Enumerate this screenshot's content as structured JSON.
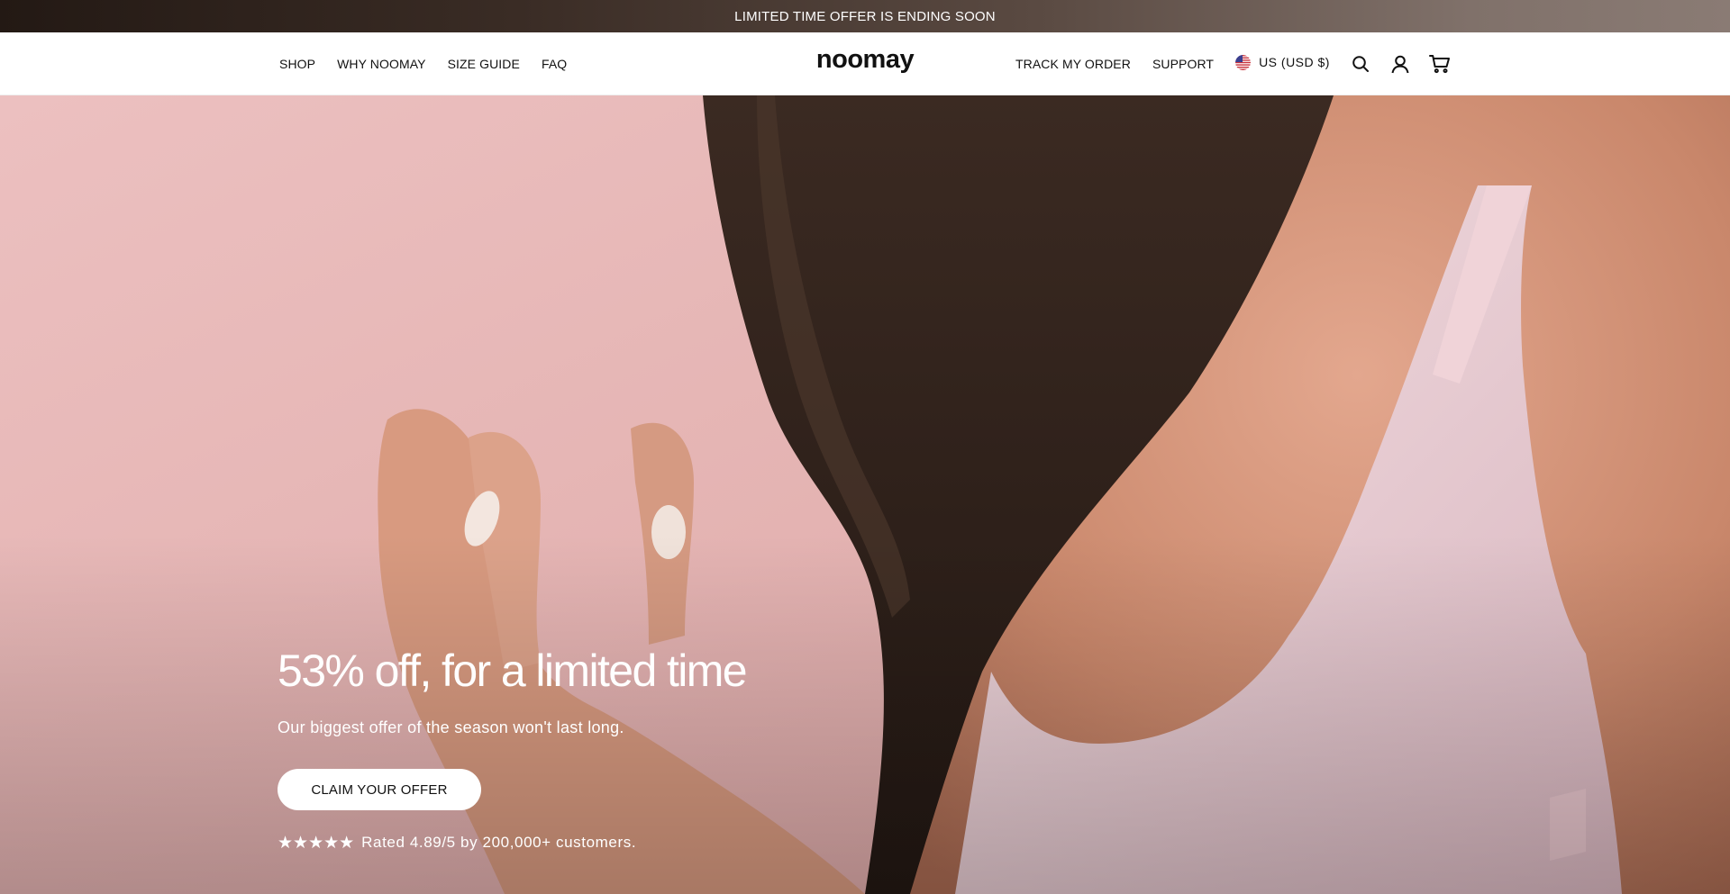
{
  "announcement": {
    "text": "LIMITED TIME OFFER IS ENDING SOON"
  },
  "header": {
    "nav_left": [
      {
        "label": "SHOP"
      },
      {
        "label": "WHY NOOMAY"
      },
      {
        "label": "SIZE GUIDE"
      },
      {
        "label": "FAQ"
      }
    ],
    "logo": {
      "text": "noomay"
    },
    "nav_right": [
      {
        "label": "TRACK MY ORDER"
      },
      {
        "label": "SUPPORT"
      }
    ],
    "currency": {
      "label": "US (USD $)",
      "flag_icon": "us-flag-icon"
    },
    "icons": [
      "search-icon",
      "account-icon",
      "cart-icon"
    ]
  },
  "hero": {
    "title": "53% off, for a limited time",
    "subtitle": "Our biggest offer of the season won't last long.",
    "cta_label": "CLAIM YOUR OFFER",
    "rating": {
      "stars": "★★★★★",
      "text": "Rated 4.89/5 by 200,000+ customers."
    }
  },
  "colors": {
    "hero_background": "#e8b8b8",
    "announcement_start": "#231914",
    "announcement_end": "#8a7b74",
    "text_dark": "#111111",
    "text_light": "#ffffff"
  }
}
